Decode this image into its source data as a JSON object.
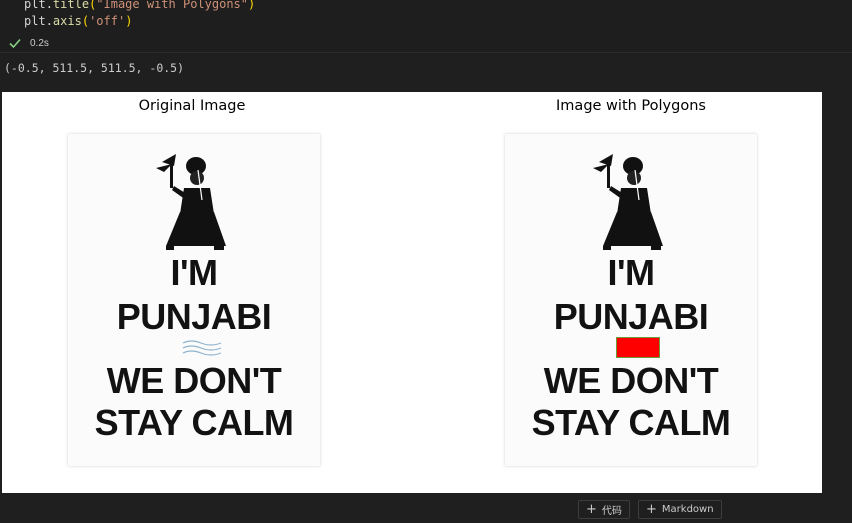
{
  "code": {
    "line1": {
      "obj": "plt",
      "fn": "title",
      "arg": "\"Image with Polygons\""
    },
    "line2": {
      "obj": "plt",
      "fn": "axis",
      "arg": "'off'"
    }
  },
  "run_status": {
    "duration": "0.2s",
    "icon": "check-icon"
  },
  "output": {
    "text": "(-0.5, 511.5, 511.5, -0.5)"
  },
  "figure": {
    "subplots": [
      {
        "title": "Original Image"
      },
      {
        "title": "Image with Polygons"
      }
    ],
    "poster": {
      "line1": "I'M",
      "line2": "PUNJABI",
      "line3": "WE DON'T",
      "line4": "STAY CALM"
    },
    "polygon_fill_color": "#ff0000"
  },
  "toolbar": {
    "add_code_label": "代码",
    "add_markdown_label": "Markdown"
  }
}
